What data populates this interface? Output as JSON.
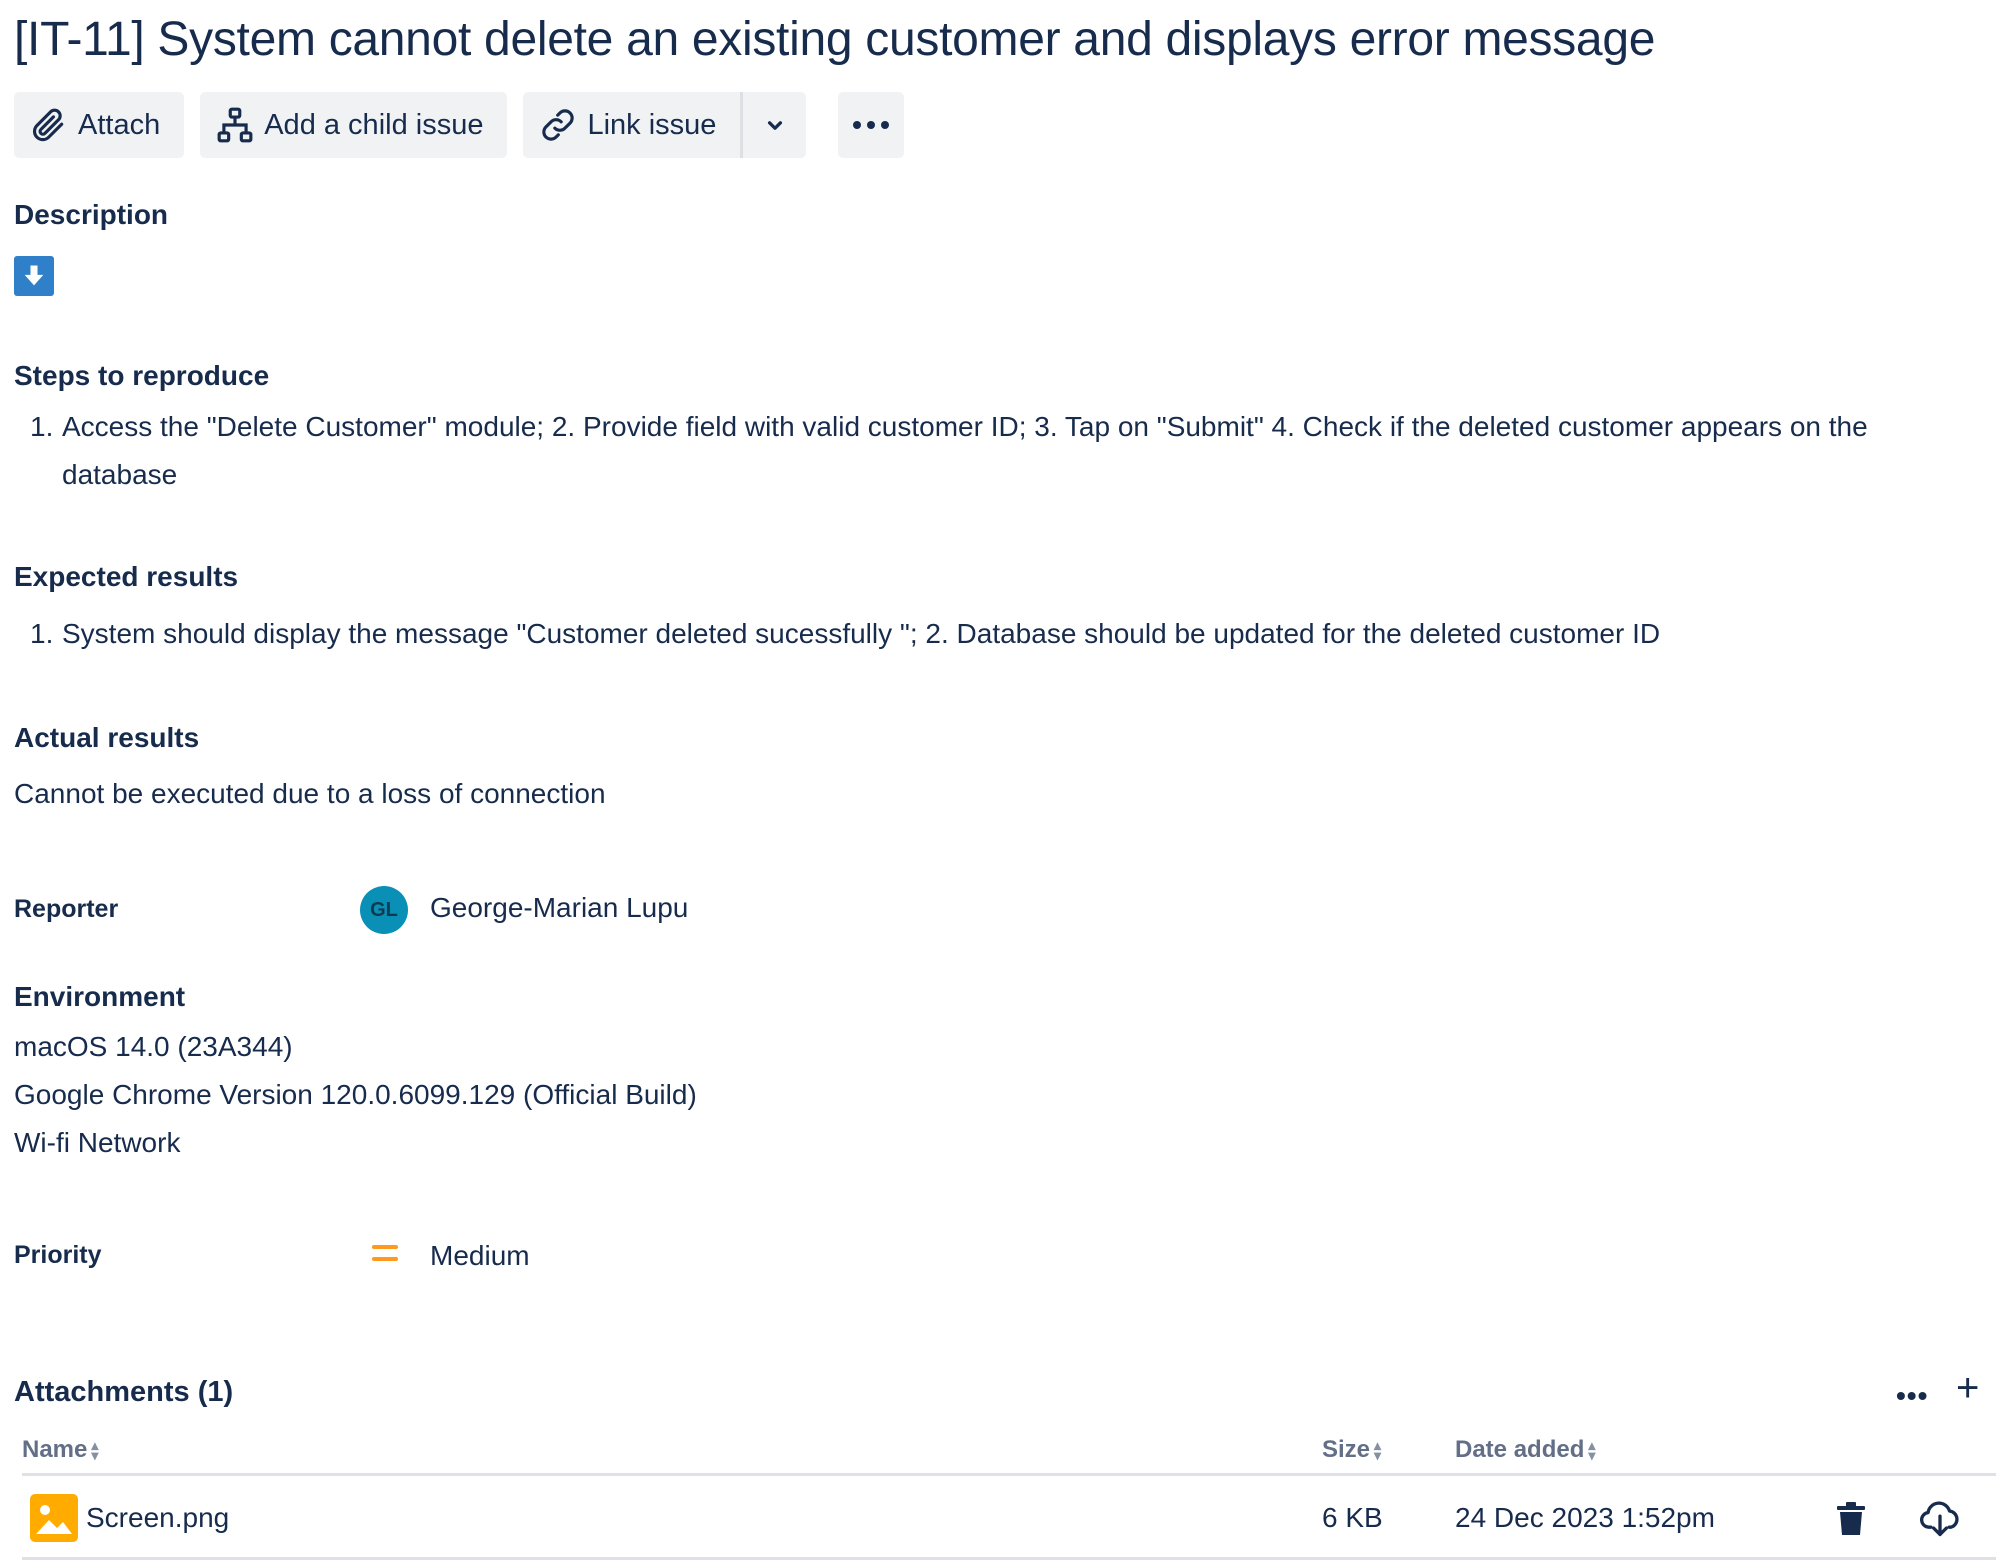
{
  "issue": {
    "title": "[IT-11] System cannot delete an existing customer and displays error message"
  },
  "toolbar": {
    "attach_label": "Attach",
    "child_issue_label": "Add a child issue",
    "link_issue_label": "Link issue"
  },
  "description": {
    "heading": "Description",
    "steps_heading": "Steps to reproduce",
    "steps_num": "1.",
    "steps_line1": "Access the \"Delete Customer\" module; 2. Provide field with valid customer ID; 3. Tap on \"Submit\" 4. Check if the deleted customer appears on the",
    "steps_line2": "database",
    "expected_heading": "Expected results",
    "expected_num": "1.",
    "expected_text": "System should display the message \"Customer deleted sucessfully \"; 2. Database should be updated for the deleted customer ID",
    "actual_heading": "Actual results",
    "actual_text": "Cannot be executed due to a loss of connection"
  },
  "reporter": {
    "label": "Reporter",
    "initials": "GL",
    "name": "George-Marian Lupu"
  },
  "environment": {
    "heading": "Environment",
    "lines": [
      "macOS 14.0 (23A344)",
      "Google Chrome Version 120.0.6099.129 (Official Build)",
      "Wi-fi Network"
    ]
  },
  "priority": {
    "label": "Priority",
    "value": "Medium",
    "color": "#ff991f"
  },
  "attachments": {
    "title": "Attachments (1)",
    "columns": {
      "name": "Name",
      "size": "Size",
      "date": "Date added"
    },
    "rows": [
      {
        "name": "Screen.png",
        "size": "6 KB",
        "date": "24 Dec 2023 1:52pm"
      }
    ]
  },
  "colors": {
    "text": "#172b4d",
    "button_bg": "#f1f2f4",
    "avatar_bg": "#0a8fb6",
    "file_icon": "#ffab00",
    "download_icon_bg": "#2f80c8"
  }
}
